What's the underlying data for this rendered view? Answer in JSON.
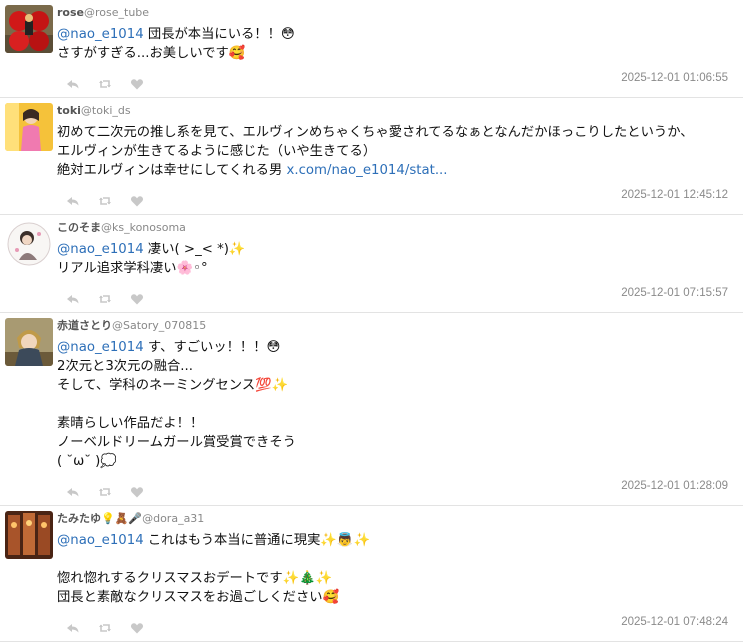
{
  "posts": [
    {
      "name": "rose",
      "handle": "@rose_tube",
      "avatar": "red-apples-figure-avatar",
      "lines": [
        [
          {
            "t": "@nao_e1014",
            "c": "mention"
          },
          {
            "t": " 団長が本当にいる！！😳",
            "c": ""
          }
        ],
        [
          {
            "t": "さすがすぎる...お美しいです🥰",
            "c": ""
          }
        ]
      ],
      "timestamp": "2025-12-01 01:06:55"
    },
    {
      "name": "toki",
      "handle": "@toki_ds",
      "avatar": "pink-outfit-person-avatar",
      "lines": [
        [
          {
            "t": "初めて二次元の推し系を見て、エルヴィンめちゃくちゃ愛されてるなぁとなんだかほっこりしたというか、",
            "c": ""
          }
        ],
        [
          {
            "t": "エルヴィンが生きてるように感じた（いや生きてる）",
            "c": ""
          }
        ],
        [
          {
            "t": "絶対エルヴィンは幸せにしてくれる男 ",
            "c": ""
          },
          {
            "t": "x.com/nao_e1014/stat...",
            "c": "link"
          }
        ]
      ],
      "timestamp": "2025-12-01 12:45:12"
    },
    {
      "name": "このそま",
      "handle": "@ks_konosoma",
      "avatar": "illustrated-character-avatar",
      "lines": [
        [
          {
            "t": "@nao_e1014",
            "c": "mention"
          },
          {
            "t": " 凄い( >_< *)✨",
            "c": ""
          }
        ],
        [
          {
            "t": "リアル追求学科凄い🌸◦°",
            "c": ""
          }
        ]
      ],
      "timestamp": "2025-12-01 07:15:57"
    },
    {
      "name": "赤道さとり",
      "handle": "@Satory_070815",
      "avatar": "anime-character-avatar",
      "lines": [
        [
          {
            "t": "@nao_e1014",
            "c": "mention"
          },
          {
            "t": " す、すごいッ！！！😳",
            "c": ""
          }
        ],
        [
          {
            "t": "2次元と3次元の融合...",
            "c": ""
          }
        ],
        [
          {
            "t": "そして、学科のネーミングセンス💯✨",
            "c": ""
          }
        ],
        [
          {
            "t": "",
            "c": ""
          }
        ],
        [
          {
            "t": "素晴らしい作品だよ！！",
            "c": ""
          }
        ],
        [
          {
            "t": "ノーベルドリームガール賞受賞できそう",
            "c": ""
          }
        ],
        [
          {
            "t": "( ˘ω˘ )💭",
            "c": ""
          }
        ]
      ],
      "timestamp": "2025-12-01 01:28:09"
    },
    {
      "name": "たみたゆ💡🧸🎤",
      "handle": "@dora_a31",
      "avatar": "warm-lit-interior-avatar",
      "lines": [
        [
          {
            "t": "@nao_e1014",
            "c": "mention"
          },
          {
            "t": " これはもう本当に普通に現実✨👼✨",
            "c": ""
          }
        ],
        [
          {
            "t": "",
            "c": ""
          }
        ],
        [
          {
            "t": "惚れ惚れするクリスマスおデートです✨🎄✨",
            "c": ""
          }
        ],
        [
          {
            "t": "団長と素敵なクリスマスをお過ごしください🥰",
            "c": ""
          }
        ]
      ],
      "timestamp": "2025-12-01 07:48:24"
    }
  ],
  "icons": {
    "reply": "reply-icon",
    "retweet": "retweet-icon",
    "like": "heart-icon"
  },
  "colors": {
    "mention": "#2d6fb8",
    "timestamp": "#8a8a8a",
    "icon": "#c8c8c8",
    "divider": "#e3e3e3"
  }
}
